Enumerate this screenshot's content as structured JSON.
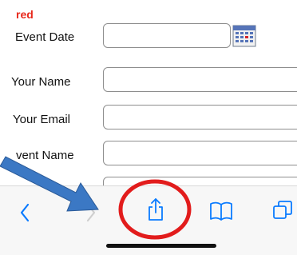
{
  "form": {
    "required_note": "red",
    "fields": [
      {
        "label": "Event Date",
        "value": ""
      },
      {
        "label": "Your Name",
        "value": ""
      },
      {
        "label": "Your Email",
        "value": ""
      },
      {
        "label": "vent Name",
        "value": ""
      }
    ],
    "calendar_icon": "calendar-icon"
  },
  "toolbar": {
    "icons": [
      "chevron-left-icon",
      "chevron-right-icon",
      "share-icon",
      "book-icon",
      "tabs-icon"
    ],
    "background": "#f7f7f7",
    "accent": "#0a7bff"
  },
  "annotations": {
    "arrow_color": "#3b78c4",
    "circle_color": "#e21c1c"
  }
}
